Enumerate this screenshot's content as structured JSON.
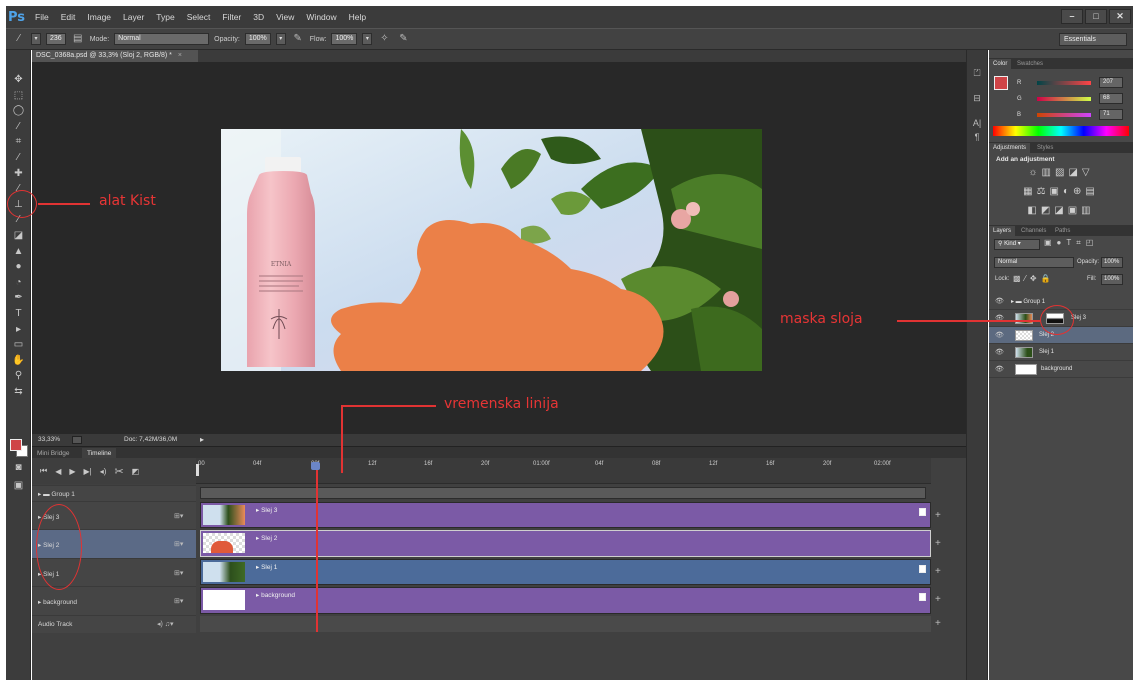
{
  "app": {
    "logo": "Ps",
    "menu": [
      "File",
      "Edit",
      "Image",
      "Layer",
      "Type",
      "Select",
      "Filter",
      "3D",
      "View",
      "Window",
      "Help"
    ],
    "window_controls": [
      "–",
      "□",
      "✕"
    ]
  },
  "options_bar": {
    "brush_size": "236",
    "mode_label": "Mode:",
    "mode_value": "Normal",
    "opacity_label": "Opacity:",
    "opacity_value": "100%",
    "flow_label": "Flow:",
    "flow_value": "100%",
    "workspace": "Essentials"
  },
  "document": {
    "tab_title": "DSC_0368a.psd @ 33,3% (Sloj 2, RGB/8) *",
    "tab_close": "×",
    "product_brand": "ETNIA",
    "zoom": "33,33%",
    "doc_size": "Doc: 7,42M/36,0M"
  },
  "timeline": {
    "tabs": [
      "Mini Bridge",
      "Timeline"
    ],
    "ruler_ticks": [
      "00",
      "04f",
      "08f",
      "12f",
      "16f",
      "20f",
      "01:00f",
      "04f",
      "08f",
      "12f",
      "16f",
      "20f",
      "02:00f"
    ],
    "tracks": [
      {
        "name": "Group 1",
        "type": "group"
      },
      {
        "name": "Slej 3",
        "clip": "Slej 3"
      },
      {
        "name": "Slej 2",
        "clip": "Slej 2"
      },
      {
        "name": "Slej 1",
        "clip": "Slej 1"
      },
      {
        "name": "background",
        "clip": "background"
      }
    ],
    "audio_label": "Audio Track"
  },
  "color_panel": {
    "tabs": [
      "Color",
      "Swatches"
    ],
    "r": "207",
    "g": "68",
    "b": "71",
    "r_label": "R",
    "g_label": "G",
    "b_label": "B",
    "color_value": "#cf4447"
  },
  "adjustments_panel": {
    "tabs": [
      "Adjustments",
      "Styles"
    ],
    "heading": "Add an adjustment"
  },
  "layers_panel": {
    "tabs": [
      "Layers",
      "Channels",
      "Paths"
    ],
    "filter_kind": "Kind",
    "blend_mode": "Normal",
    "opacity_label": "Opacity:",
    "opacity_value": "100%",
    "lock_label": "Lock:",
    "fill_label": "Fill:",
    "fill_value": "100%",
    "layers": [
      {
        "name": "Group 1"
      },
      {
        "name": "Slej 3"
      },
      {
        "name": "Slej 2"
      },
      {
        "name": "Slej 1"
      },
      {
        "name": "background"
      }
    ]
  },
  "annotations": {
    "brush_tool": "alat Kist",
    "layer_mask": "maska sloja",
    "timeline": "vremenska linija"
  },
  "colors": {
    "accent_annotation": "#e13333",
    "clip_purple": "#7b5aa6",
    "clip_blue": "#4c6b9a",
    "orange_mask": "#eb8048"
  }
}
